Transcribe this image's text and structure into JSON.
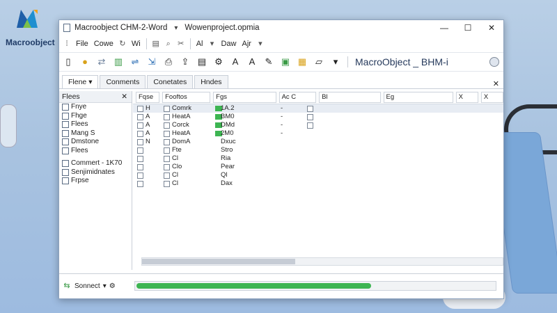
{
  "logo": {
    "text": "Macroobject"
  },
  "window": {
    "title": "Macroobject CHM-2-Word",
    "subtitle": "Wowenproject.opmia",
    "controls": {
      "minimize": "—",
      "maximize": "☐",
      "close": "✕"
    }
  },
  "toolbar": {
    "file": "File",
    "cowe": "Cowe",
    "wi": "Wi",
    "ai": "Al",
    "daw": "Daw",
    "ajr": "Ajr"
  },
  "ribbon": {
    "title": "MacroObject _ BHM-i"
  },
  "tabs": [
    {
      "label": "Flene"
    },
    {
      "label": "Conments"
    },
    {
      "label": "Conetates"
    },
    {
      "label": "Hndes"
    }
  ],
  "sidebar": {
    "header": "Flees",
    "items": [
      "Fnye",
      "Fhge",
      "Flees",
      "Mang S",
      "Dmstone",
      "Flees"
    ],
    "items2": [
      "Commert - 1K70",
      "Senjimidnates",
      "Frpse"
    ]
  },
  "grid": {
    "headers": [
      "Fqse",
      "Fooftos",
      "Fgs",
      "Ac C",
      "Bl",
      "Eg",
      "X",
      "X"
    ],
    "rows": [
      {
        "c1": "H",
        "c2": "Comrk",
        "c3": "1A.2",
        "c4": "-",
        "check": true
      },
      {
        "c1": "A",
        "c2": "HeatA",
        "c3": "BM0",
        "c4": "-",
        "check": false
      },
      {
        "c1": "A",
        "c2": "Corck",
        "c3": "DMd",
        "c4": "-",
        "check": false
      },
      {
        "c1": "A",
        "c2": "HeatA",
        "c3": "2M0",
        "c4": "-",
        "check": false
      },
      {
        "c1": "N",
        "c2": "DomA",
        "c3": "Dxuc",
        "c4": "",
        "check": false
      },
      {
        "c1": "",
        "c2": "Fte",
        "c3": "Stro",
        "c4": "",
        "check": false
      },
      {
        "c1": "",
        "c2": "Cl",
        "c3": "Ria",
        "c4": "",
        "check": false
      },
      {
        "c1": "",
        "c2": "Clo",
        "c3": "Pear",
        "c4": "",
        "check": false
      },
      {
        "c1": "",
        "c2": "Cl",
        "c3": "Ql",
        "c4": "",
        "check": false
      },
      {
        "c1": "",
        "c2": "Cl",
        "c3": "Dax",
        "c4": "",
        "check": false
      }
    ]
  },
  "status": {
    "label": "Sonnect",
    "progress": 0.65
  }
}
